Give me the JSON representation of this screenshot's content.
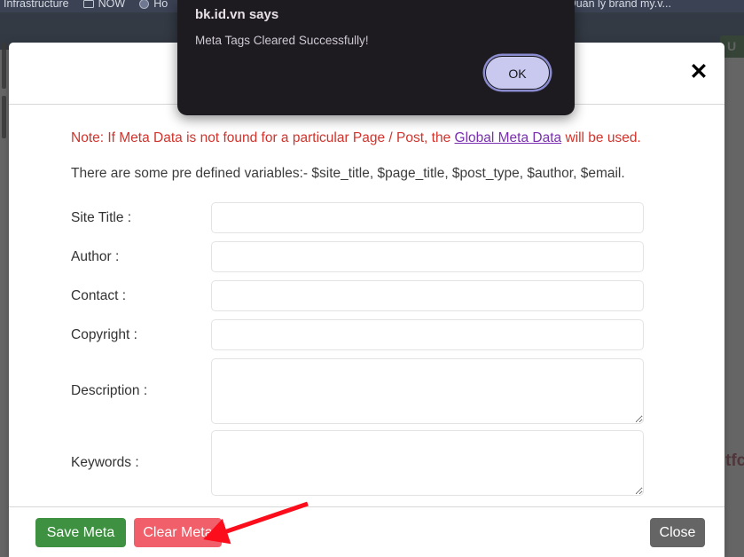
{
  "browser": {
    "bookmarks": [
      {
        "label": "Infrastructure",
        "icon": "folder-icon"
      },
      {
        "label": "NOW",
        "icon": "folder-icon"
      },
      {
        "label": "Ho",
        "icon": "globe-icon"
      }
    ],
    "bookmark_right": "Quản lý brand my.v..."
  },
  "page": {
    "navbar_button_label": "U",
    "background_text": "tfc"
  },
  "modal": {
    "title": "",
    "close_icon": "✕",
    "note": {
      "prefix": "Note: If Meta Data is not found for a particular Page / Post, the ",
      "link": "Global Meta Data",
      "suffix": " will be used."
    },
    "subnote": "There are some pre defined variables:- $site_title, $page_title, $post_type, $author, $email.",
    "fields": [
      {
        "label": "Site Title :",
        "value": "",
        "placeholder": "",
        "type": "text"
      },
      {
        "label": "Author :",
        "value": "",
        "placeholder": "",
        "type": "text"
      },
      {
        "label": "Contact :",
        "value": "",
        "placeholder": "",
        "type": "text"
      },
      {
        "label": "Copyright :",
        "value": "",
        "placeholder": "",
        "type": "text"
      },
      {
        "label": "Description :",
        "value": "",
        "placeholder": "",
        "type": "textarea"
      },
      {
        "label": "Keywords :",
        "value": "",
        "placeholder": "",
        "type": "textarea"
      }
    ],
    "footer": {
      "save_label": "Save Meta",
      "clear_label": "Clear Meta",
      "close_label": "Close"
    }
  },
  "alert_dialog": {
    "title": "bk.id.vn says",
    "message": "Meta Tags Cleared Successfully!",
    "ok_label": "OK"
  },
  "annotation": {
    "arrow_color": "#fc0d1b",
    "points_to": "clear-meta-button"
  },
  "colors": {
    "note_red": "#d0342c",
    "link_purple": "#7a2fb0",
    "save_green": "#3f9142",
    "clear_red": "#f1606a",
    "close_gray": "#656565",
    "navbar_blue": "#1d3d6b",
    "dialog_bg": "#1d1b20",
    "ok_lavender": "#c9c9f0"
  }
}
